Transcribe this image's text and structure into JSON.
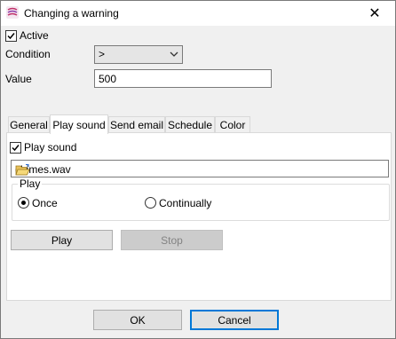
{
  "window": {
    "title": "Changing a warning",
    "close_symbol": "✕"
  },
  "form": {
    "active_label": "Active",
    "active_checked": true,
    "condition_label": "Condition",
    "condition_value": ">",
    "value_label": "Value",
    "value_value": "500"
  },
  "tabs": [
    {
      "label": "General",
      "active": false
    },
    {
      "label": "Play sound",
      "active": true
    },
    {
      "label": "Send email",
      "active": false
    },
    {
      "label": "Schedule",
      "active": false
    },
    {
      "label": "Color",
      "active": false
    }
  ],
  "play_sound": {
    "checkbox_label": "Play sound",
    "checked": true,
    "file": "chimes.wav",
    "group_title": "Play",
    "option_once": "Once",
    "option_continually": "Continually",
    "selected": "once",
    "play_button": "Play",
    "stop_button": "Stop"
  },
  "footer": {
    "ok_label": "OK",
    "cancel_label": "Cancel"
  },
  "icons": {
    "app": "app-logo-icon",
    "folder": "open-folder-icon",
    "close": "close-icon",
    "chevron": "chevron-down-icon"
  }
}
